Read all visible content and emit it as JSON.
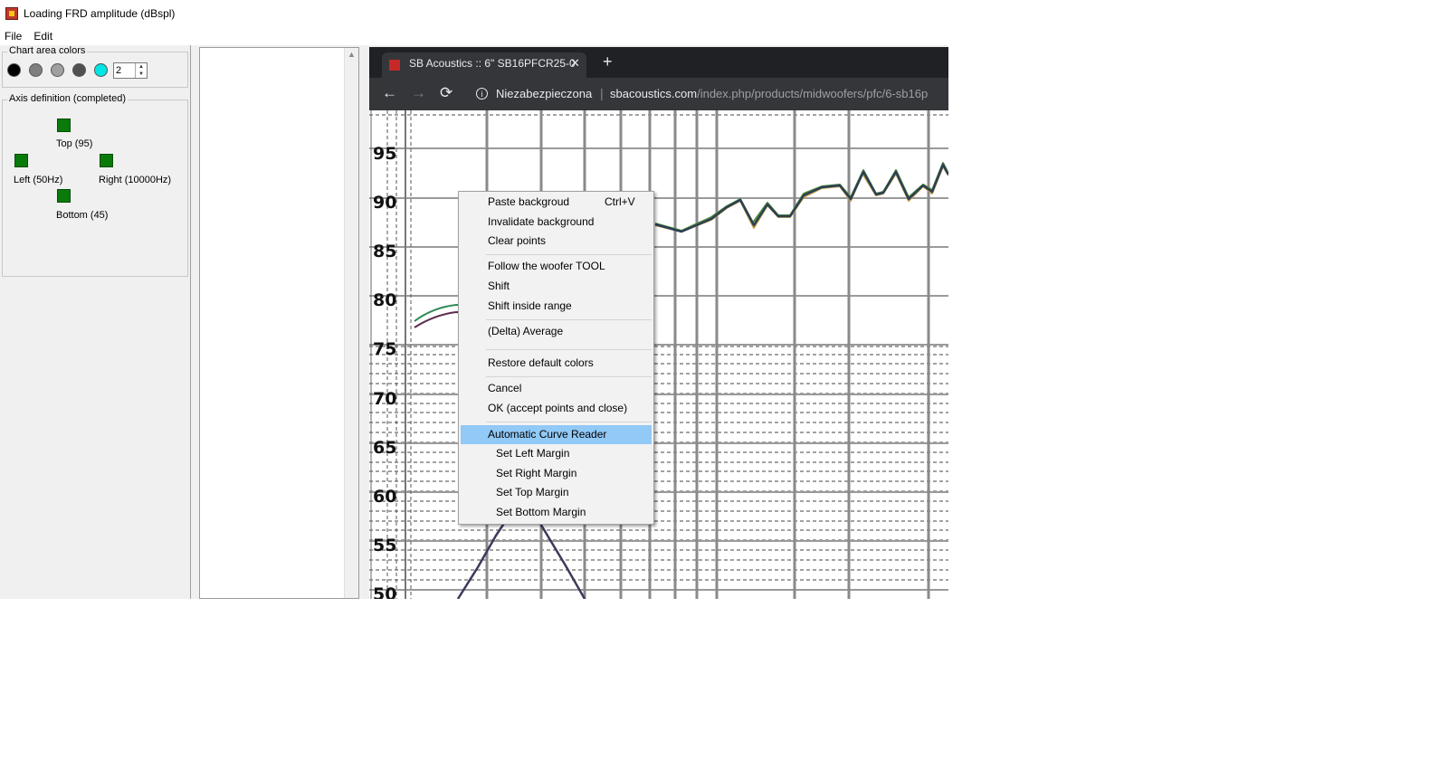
{
  "window": {
    "title": "Loading FRD amplitude (dBspl)"
  },
  "menubar": {
    "items": [
      "File",
      "Edit"
    ]
  },
  "chart_area_colors": {
    "legend": "Chart area colors",
    "colors": [
      "#000000",
      "#7f7f7f",
      "#a0a0a0",
      "#505050",
      "#00e5e5"
    ],
    "spin_value": "2"
  },
  "axis_definition": {
    "legend": "Axis definition (completed)",
    "top": "Top (95)",
    "left": "Left (50Hz)",
    "right": "Right (10000Hz)",
    "bottom": "Bottom (45)",
    "marker_color": "#0a7a0a"
  },
  "browser": {
    "tab_title": "SB Acoustics :: 6\" SB16PFCR25-0",
    "tab_close": "✕",
    "new_tab": "+",
    "back": "←",
    "forward": "→",
    "reload": "⟳",
    "info": "i",
    "insecure_label": "Niezabezpieczona",
    "separator": "|",
    "url_domain": "sbacoustics.com",
    "url_path": "/index.php/products/midwoofers/pfc/6-sb16p"
  },
  "graph": {
    "y_tick_labels": [
      "95",
      "90",
      "85",
      "80",
      "75",
      "70",
      "65",
      "60",
      "55",
      "50"
    ]
  },
  "context_menu": {
    "items": [
      {
        "label": "Paste backgroud",
        "shortcut": "Ctrl+V"
      },
      {
        "label": "Invalidate background"
      },
      {
        "label": "Clear points"
      },
      {
        "label": "Follow the woofer TOOL"
      },
      {
        "label": "Shift"
      },
      {
        "label": "Shift inside range"
      },
      {
        "label": "(Delta) Average"
      },
      {
        "label": "Restore default colors"
      },
      {
        "label": "Cancel"
      },
      {
        "label": "OK (accept points and close)"
      },
      {
        "label": "Automatic Curve Reader"
      },
      {
        "label": "Set Left Margin"
      },
      {
        "label": "Set Right Margin"
      },
      {
        "label": "Set Top Margin"
      },
      {
        "label": "Set Bottom Margin"
      }
    ],
    "highlight_color": "#91c9f7"
  }
}
